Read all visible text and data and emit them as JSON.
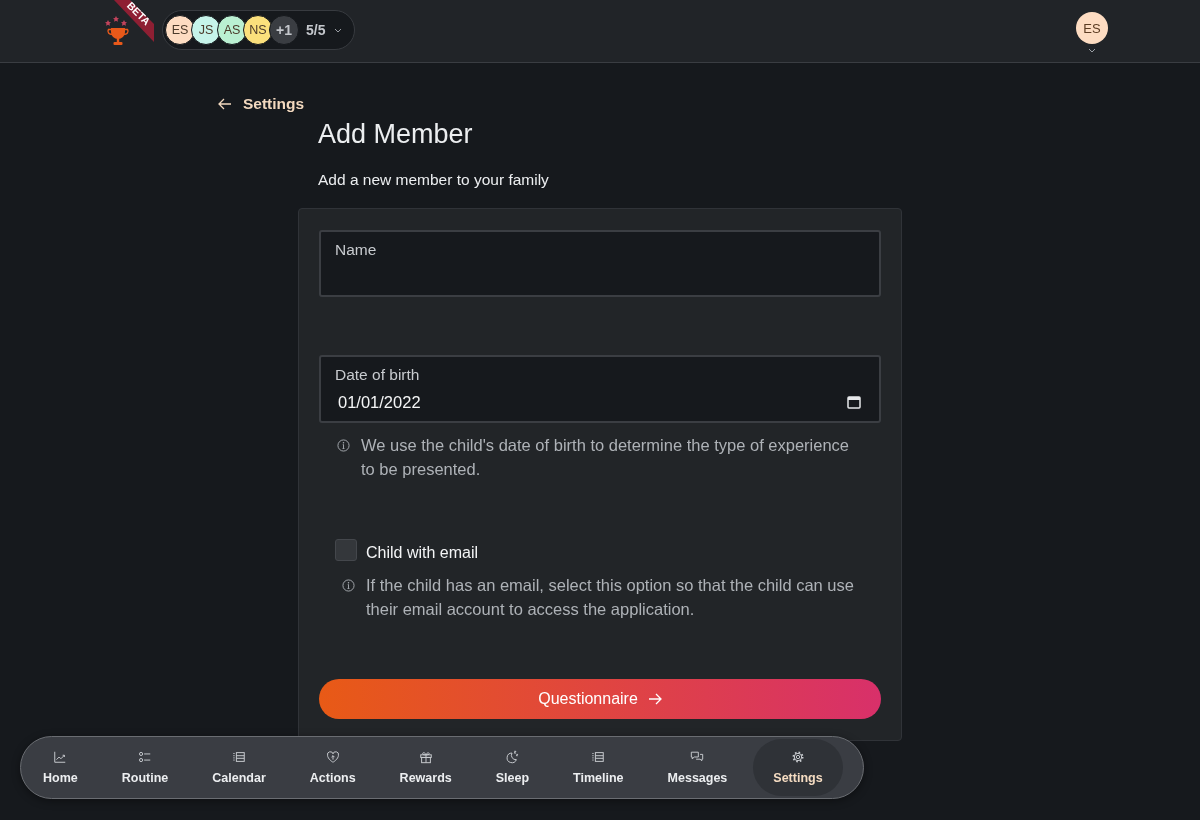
{
  "header": {
    "logo_badge": "BETA",
    "members": [
      {
        "initials": "ES",
        "color": "#fddcc2"
      },
      {
        "initials": "JS",
        "color": "#c6f4ea"
      },
      {
        "initials": "AS",
        "color": "#baf0d2"
      },
      {
        "initials": "NS",
        "color": "#fbe07c"
      }
    ],
    "overflow_count": "+1",
    "member_count": "5/5",
    "user": {
      "initials": "ES",
      "color": "#fddcc2"
    }
  },
  "back_link": "Settings",
  "title": "Add Member",
  "subtitle": "Add a new member to your family",
  "form": {
    "fields": [
      {
        "kind": "text",
        "label": "Name"
      },
      {
        "kind": "date",
        "label": "Date of birth",
        "value": "01/01/2022",
        "help": "We use the child's date of birth to determine the type of experience to be presented."
      },
      {
        "kind": "checkbox",
        "label": "Child with email",
        "checked": false,
        "help": "If the child has an email, select this option so that the child can use their email account to access the application."
      }
    ],
    "submit": "Questionnaire"
  },
  "nav": {
    "items": [
      {
        "label": "Home",
        "selected": false
      },
      {
        "label": "Routine",
        "selected": false
      },
      {
        "label": "Calendar",
        "selected": false
      },
      {
        "label": "Actions",
        "selected": false
      },
      {
        "label": "Rewards",
        "selected": false
      },
      {
        "label": "Sleep",
        "selected": false
      },
      {
        "label": "Timeline",
        "selected": false
      },
      {
        "label": "Messages",
        "selected": false
      },
      {
        "label": "Settings",
        "selected": true
      }
    ]
  }
}
